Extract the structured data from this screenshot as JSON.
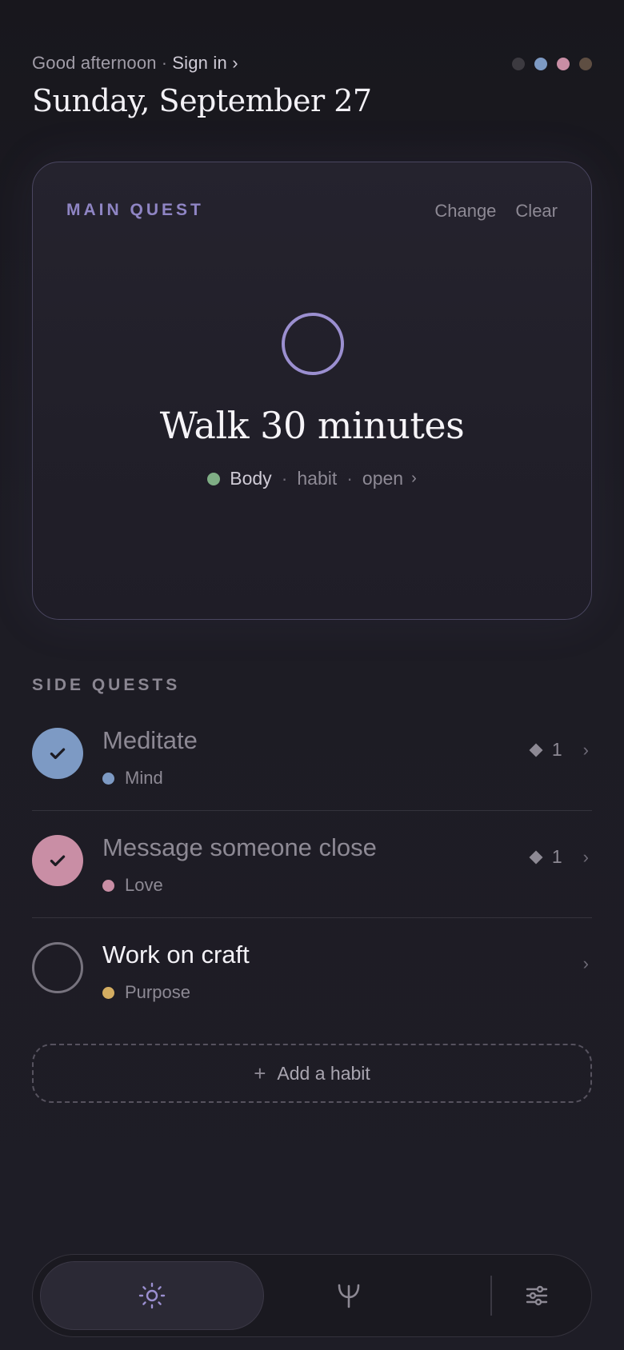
{
  "header": {
    "greeting": "Good afternoon",
    "separator": "·",
    "sign_in": "Sign in ›",
    "date": "Sunday, September 27",
    "theme_dots": [
      {
        "name": "theme-dot-default",
        "color": "#3c3a40"
      },
      {
        "name": "theme-dot-blue",
        "color": "#7d9ac4"
      },
      {
        "name": "theme-dot-pink",
        "color": "#c98ea5"
      },
      {
        "name": "theme-dot-brown",
        "color": "#5e4e42"
      }
    ]
  },
  "main_quest": {
    "label": "MAIN QUEST",
    "change": "Change",
    "clear": "Clear",
    "title": "Walk 30 minutes",
    "category": "Body",
    "category_color": "#7fae85",
    "type": "habit",
    "status": "open",
    "chevron": "›"
  },
  "side_quests": {
    "title": "SIDE QUESTS",
    "items": [
      {
        "title": "Meditate",
        "category": "Mind",
        "color": "#7d9ac4",
        "done": true,
        "count": "1",
        "chevron": "›"
      },
      {
        "title": "Message someone close",
        "category": "Love",
        "color": "#c98ea5",
        "done": true,
        "count": "1",
        "chevron": "›"
      },
      {
        "title": "Work on craft",
        "category": "Purpose",
        "color": "#d4ad61",
        "done": false,
        "count": "",
        "chevron": "›"
      }
    ]
  },
  "add_habit": {
    "plus": "+",
    "label": "Add a habit"
  },
  "nav": {
    "items": [
      {
        "icon": "sun-icon",
        "active": true
      },
      {
        "icon": "branch-icon",
        "active": false
      },
      {
        "icon": "sliders-icon",
        "active": false
      }
    ]
  },
  "accent": "#9b8fd0"
}
